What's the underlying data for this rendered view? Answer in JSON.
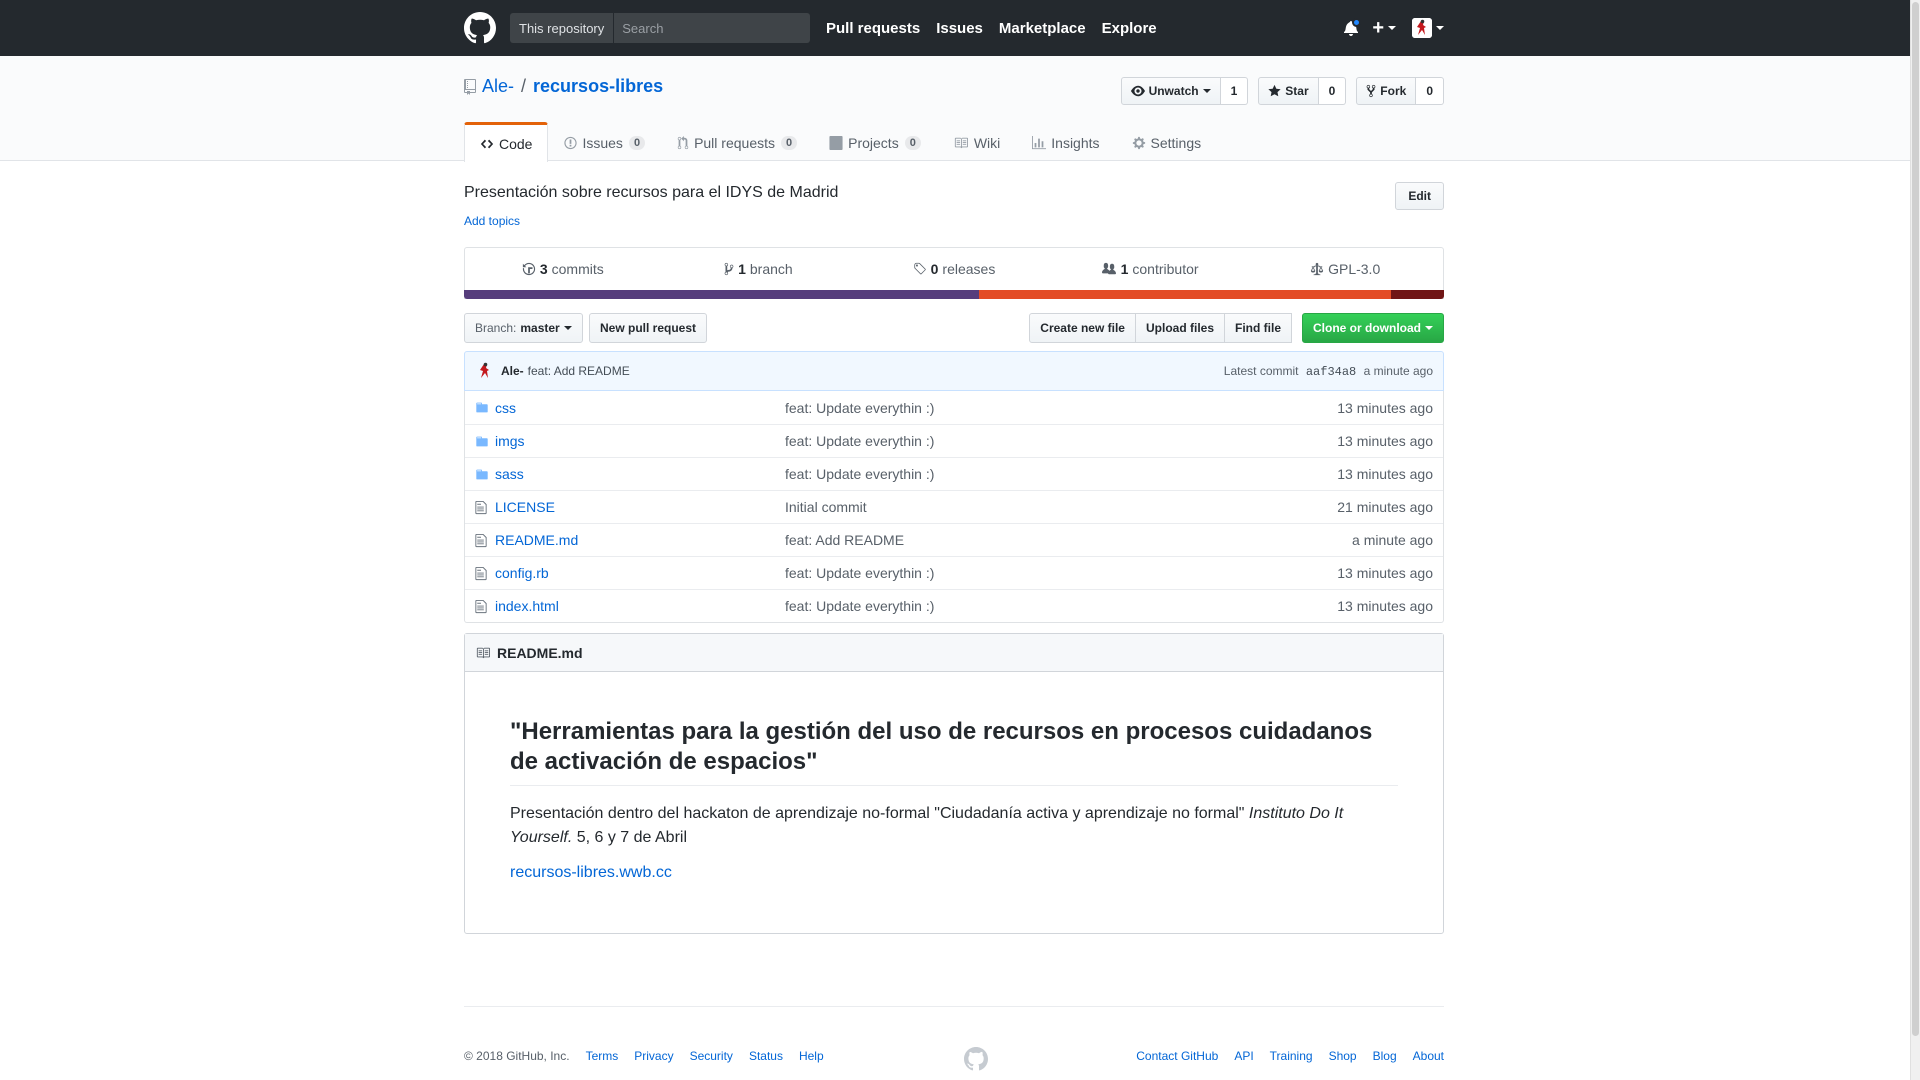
{
  "header": {
    "search_scope": "This repository",
    "search_placeholder": "Search",
    "nav": [
      "Pull requests",
      "Issues",
      "Marketplace",
      "Explore"
    ],
    "plus_label": "+"
  },
  "repo": {
    "owner": "Ale-",
    "separator": "/",
    "name": "recursos-libres",
    "actions": {
      "watch_label": "Unwatch",
      "watch_count": "1",
      "star_label": "Star",
      "star_count": "0",
      "fork_label": "Fork",
      "fork_count": "0"
    },
    "tabs": [
      {
        "label": "Code"
      },
      {
        "label": "Issues",
        "count": "0"
      },
      {
        "label": "Pull requests",
        "count": "0"
      },
      {
        "label": "Projects",
        "count": "0"
      },
      {
        "label": "Wiki"
      },
      {
        "label": "Insights"
      },
      {
        "label": "Settings"
      }
    ]
  },
  "description": {
    "text": "Presentación sobre recursos para el IDYS de Madrid",
    "add_topics": "Add topics",
    "edit_label": "Edit"
  },
  "summary": {
    "commits_count": "3",
    "commits_label": "commits",
    "branch_count": "1",
    "branch_label": "branch",
    "releases_count": "0",
    "releases_label": "releases",
    "contributor_count": "1",
    "contributor_label": "contributor",
    "license": "GPL-3.0",
    "language_colors": [
      "#563d7c",
      "#e34c26",
      "#701516"
    ],
    "language_shares": [
      0.526,
      0.42,
      0.054
    ]
  },
  "file_nav": {
    "branch_prefix": "Branch:",
    "branch_name": "master",
    "new_pr": "New pull request",
    "create_file": "Create new file",
    "upload_files": "Upload files",
    "find_file": "Find file",
    "clone": "Clone or download"
  },
  "latest_commit": {
    "author": "Ale-",
    "message": "feat: Add README",
    "prefix": "Latest commit",
    "sha": "aaf34a8",
    "age": "a minute ago"
  },
  "files": [
    {
      "name": "css",
      "type": "dir",
      "message": "feat: Update everythin :)",
      "age": "13 minutes ago"
    },
    {
      "name": "imgs",
      "type": "dir",
      "message": "feat: Update everythin :)",
      "age": "13 minutes ago"
    },
    {
      "name": "sass",
      "type": "dir",
      "message": "feat: Update everythin :)",
      "age": "13 minutes ago"
    },
    {
      "name": "LICENSE",
      "type": "file",
      "message": "Initial commit",
      "age": "21 minutes ago"
    },
    {
      "name": "README.md",
      "type": "file",
      "message": "feat: Add README",
      "age": "a minute ago"
    },
    {
      "name": "config.rb",
      "type": "file",
      "message": "feat: Update everythin :)",
      "age": "13 minutes ago"
    },
    {
      "name": "index.html",
      "type": "file",
      "message": "feat: Update everythin :)",
      "age": "13 minutes ago"
    }
  ],
  "readme": {
    "filename": "README.md",
    "title": "\"Herramientas para la gestión del uso de recursos en procesos cuidadanos de activación de espacios\"",
    "para_text": "Presentación dentro del hackaton de aprendizaje no-formal \"Ciudadanía activa y aprendizaje no formal\" ",
    "para_italic": "Instituto Do It Yourself.",
    "para_end": " 5, 6 y 7 de Abril",
    "link": "recursos-libres.wwb.cc"
  },
  "footer": {
    "copyright": "© 2018 GitHub, Inc.",
    "left_links": [
      "Terms",
      "Privacy",
      "Security",
      "Status",
      "Help"
    ],
    "right_links": [
      "Contact GitHub",
      "API",
      "Training",
      "Shop",
      "Blog",
      "About"
    ]
  }
}
